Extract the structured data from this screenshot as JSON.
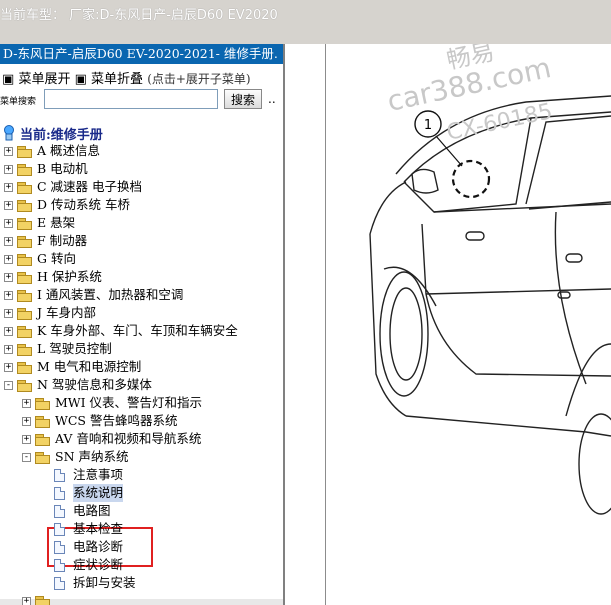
{
  "window": {
    "caption": "当前车型：  厂家:D-东风日产-启辰D60 EV2020"
  },
  "panel": {
    "title": "D-东风日产-启辰D60 EV-2020-2021- 维修手册.",
    "menu_expand": "菜单展开",
    "menu_collapse": "菜单折叠",
    "menu_hint": "(点击+展开子菜单)",
    "search_label": "菜单搜索",
    "search_value": "",
    "search_button": "搜索",
    "more": "..",
    "root": "当前:维修手册"
  },
  "tree": [
    {
      "label": "A 概述信息"
    },
    {
      "label": "B 电动机"
    },
    {
      "label": "C 减速器 电子换档"
    },
    {
      "label": "D 传动系统 车桥"
    },
    {
      "label": "E 悬架"
    },
    {
      "label": "F 制动器"
    },
    {
      "label": "G 转向"
    },
    {
      "label": "H 保护系统"
    },
    {
      "label": "I 通风装置、加热器和空调"
    },
    {
      "label": "J 车身内部"
    },
    {
      "label": "K 车身外部、车门、车顶和车辆安全"
    },
    {
      "label": "L 驾驶员控制"
    },
    {
      "label": "M 电气和电源控制"
    },
    {
      "label": "N 驾驶信息和多媒体"
    }
  ],
  "subtree": [
    {
      "label": "MWI 仪表、警告灯和指示"
    },
    {
      "label": "WCS 警告蜂鸣器系统"
    },
    {
      "label": "AV 音响和视频和导航系统"
    },
    {
      "label": "SN 声纳系统"
    }
  ],
  "docs": [
    {
      "label": "注意事项"
    },
    {
      "label": "系统说明"
    },
    {
      "label": "电路图"
    },
    {
      "label": "基本检查"
    },
    {
      "label": "电路诊断"
    },
    {
      "label": "症状诊断"
    },
    {
      "label": "拆卸与安装"
    }
  ],
  "figure": {
    "callout": "1"
  },
  "watermark": {
    "line1": "畅易",
    "line2": "car388.com",
    "line3": "CX-60185"
  },
  "colors": {
    "titlebar": "#0a66b0",
    "highlight": "#e02020"
  }
}
